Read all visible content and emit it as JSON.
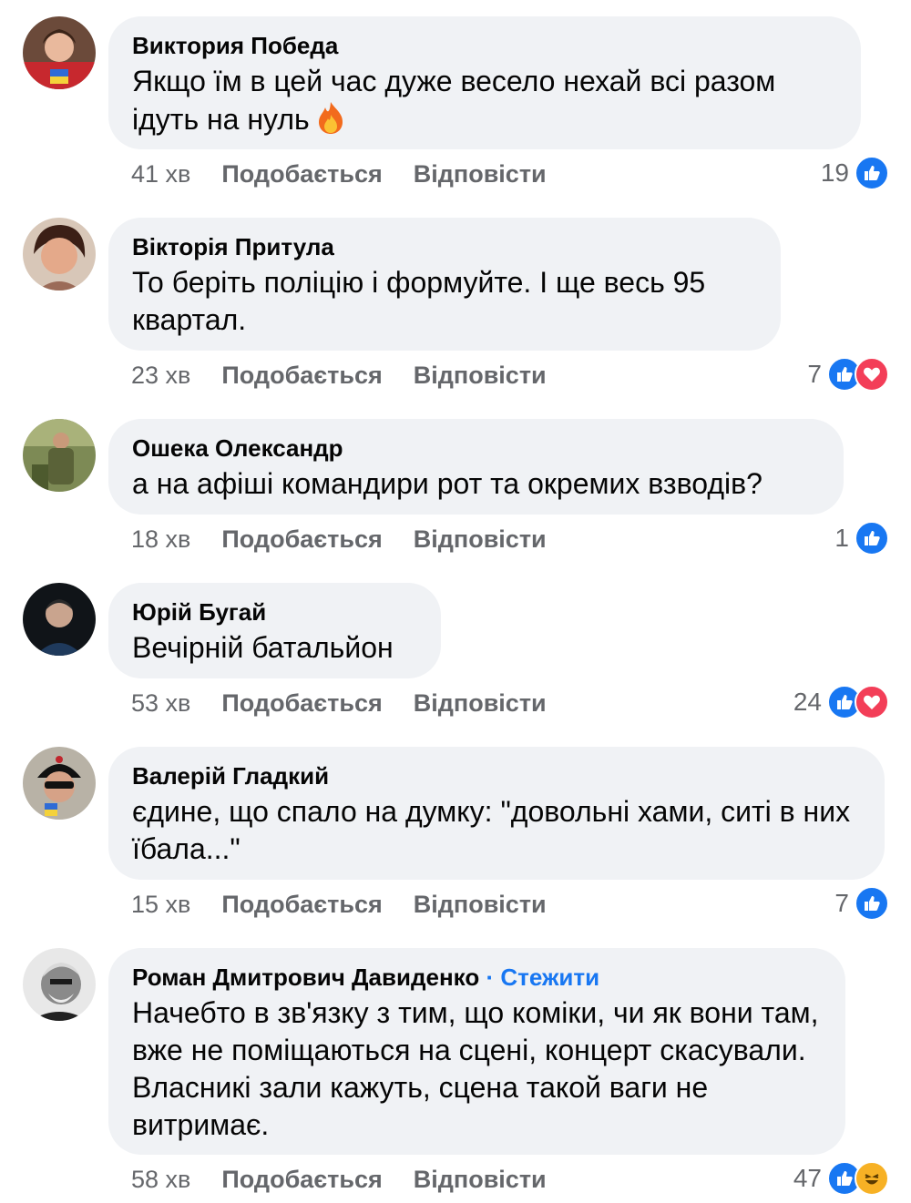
{
  "actions": {
    "like_label": "Подобається",
    "reply_label": "Відповісти"
  },
  "colors": {
    "like": "#1877f2",
    "love": "#f33e58",
    "haha": "#f7b125",
    "follow_link": "#1877f2",
    "bubble": "#f0f2f5",
    "meta": "#65676b"
  },
  "comments": [
    {
      "author": "Виктория Победа",
      "text": "Якщо їм в цей час дуже весело нехай всі разом ідуть на нуль",
      "emoji": "fire-icon",
      "time": "41 хв",
      "reaction_count": "19",
      "reactions": [
        "like-icon"
      ]
    },
    {
      "author": "Вікторія Притула",
      "text": "То беріть поліцію і формуйте. І ще весь 95 квартал.",
      "time": "23 хв",
      "reaction_count": "7",
      "reactions": [
        "like-icon",
        "love-icon"
      ]
    },
    {
      "author": "Ошека Олександр",
      "text": "а на афіші командири рот та окремих взводів?",
      "time": "18 хв",
      "reaction_count": "1",
      "reactions": [
        "like-icon"
      ]
    },
    {
      "author": "Юрій Бугай",
      "text": "Вечірній батальйон",
      "time": "53 хв",
      "reaction_count": "24",
      "reactions": [
        "like-icon",
        "love-icon"
      ]
    },
    {
      "author": "Валерій Гладкий",
      "text": "єдине, що спало на думку: \"довольні хами, ситі в них їбала...\"",
      "time": "15 хв",
      "reaction_count": "7",
      "reactions": [
        "like-icon"
      ]
    },
    {
      "author": "Роман Дмитрович Давиденко",
      "follow_label": "Стежити",
      "text": "Начебто в зв'язку з тим, що коміки, чи як вони там, вже не поміщаються на сцені, концерт скасували. Власникі зали кажуть, сцена такой ваги не витримає.",
      "time": "58 хв",
      "reaction_count": "47",
      "reactions": [
        "like-icon",
        "haha-icon"
      ]
    }
  ]
}
